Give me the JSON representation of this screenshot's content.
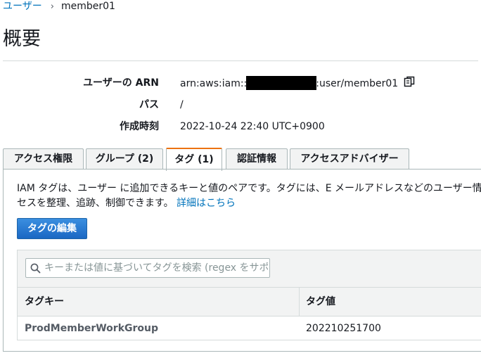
{
  "breadcrumb": {
    "parent": "ユーザー",
    "separator": "›",
    "current": "member01"
  },
  "page": {
    "title": "概要"
  },
  "summary": {
    "arn_label": "ユーザーの ARN",
    "arn_prefix": "arn:aws:iam::",
    "arn_suffix": ":user/member01",
    "path_label": "パス",
    "path_value": "/",
    "created_label": "作成時刻",
    "created_value": "2022-10-24 22:40 UTC+0900"
  },
  "tabs": [
    {
      "label": "アクセス権限"
    },
    {
      "label": "グループ (2)"
    },
    {
      "label": "タグ (1)",
      "active": true
    },
    {
      "label": "認証情報"
    },
    {
      "label": "アクセスアドバイザー"
    }
  ],
  "tags_panel": {
    "description_line1": "IAM タグは、ユーザー に追加できるキーと値のペアです。タグには、E メールアドレスなどのユーザー情",
    "description_line2": "セスを整理、追跡、制御できます。",
    "learn_more": "詳細はこちら",
    "edit_button": "タグの編集",
    "search_placeholder": "キーまたは値に基づいてタグを検索 (regex をサポート)",
    "columns": [
      "タグキー",
      "タグ値"
    ],
    "rows": [
      {
        "key": "ProdMemberWorkGroup",
        "value": "202210251700"
      }
    ]
  },
  "colors": {
    "link": "#0073bb",
    "active_tab": "#ec7211",
    "primary_button": "#1a67c3"
  }
}
